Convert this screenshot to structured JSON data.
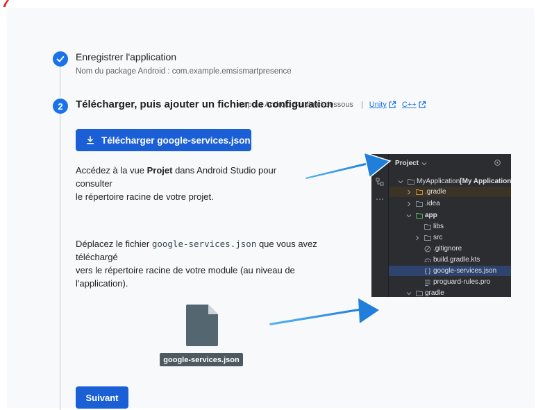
{
  "steps": {
    "step1": {
      "title": "Enregistrer l'application",
      "subtitle": "Nom du package Android : com.example.emsismartpresence"
    },
    "step2": {
      "number": "2",
      "title": "Télécharger, puis ajouter un fichier de configuration",
      "instructions_tail": "ns pour Android Studio ci-dessous",
      "separator": "|",
      "links": [
        "Unity",
        "C++"
      ]
    }
  },
  "download_button": "Télécharger google-services.json",
  "paragraph1": {
    "before": "Accédez à la vue ",
    "bold": "Projet",
    "line1_after": " dans Android Studio pour",
    "line2": "consulter",
    "line3": "le répertoire racine de votre projet."
  },
  "paragraph2": {
    "before": "Déplacez le fichier ",
    "code": "google-services.json",
    "line1_after": " que vous avez",
    "line2": "téléchargé",
    "line3": "vers le répertoire racine de votre module (au niveau de",
    "line4": "l'application)."
  },
  "file": {
    "label": "google-services.json"
  },
  "next_button": "Suivant",
  "ide": {
    "header": "Project",
    "rail_more": "⋯",
    "tree": [
      {
        "label": "MyApplication",
        "bold_suffix": " [My Application]",
        "icon": "folder-icon"
      },
      {
        "label": ".gradle",
        "icon": "folder-icon"
      },
      {
        "label": ".idea",
        "icon": "folder-icon"
      },
      {
        "label": "app",
        "icon": "module-folder-icon"
      },
      {
        "label": "libs",
        "icon": "folder-icon"
      },
      {
        "label": "src",
        "icon": "folder-icon"
      },
      {
        "label": ".gitignore",
        "icon": "ignore-icon"
      },
      {
        "label": "build.gradle.kts",
        "icon": "gradle-icon"
      },
      {
        "label": "google-services.json",
        "icon": "json-braces-icon"
      },
      {
        "label": "proguard-rules.pro",
        "icon": "text-file-icon"
      },
      {
        "label": "gradle",
        "icon": "folder-icon"
      }
    ]
  },
  "colors": {
    "primary_blue": "#1a73e8",
    "button_blue": "#1a5fd6",
    "arrow_blue": "#2e8ee6",
    "ide_bg": "#2b2d30",
    "ide_selection": "#2e436e",
    "red_mark": "#e8211a"
  }
}
